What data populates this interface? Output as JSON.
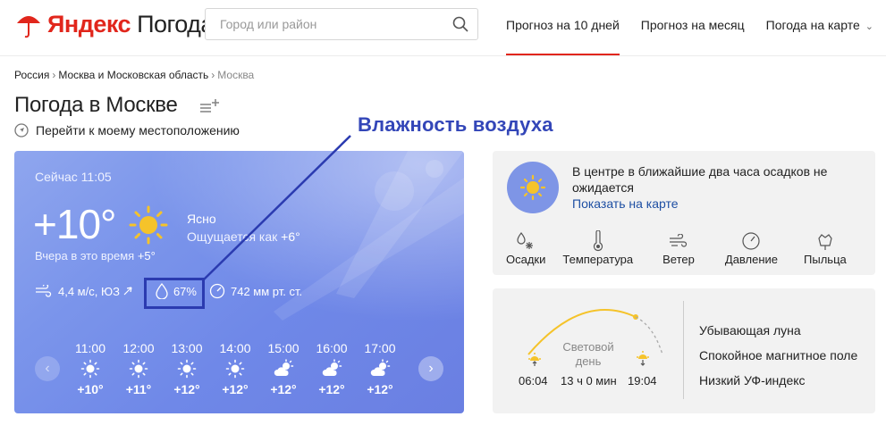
{
  "header": {
    "logo_brand": "Яндекс",
    "logo_product": "Погода",
    "search_placeholder": "Город или район",
    "nav": [
      {
        "label": "Прогноз на 10 дней",
        "active": true
      },
      {
        "label": "Прогноз на месяц",
        "active": false
      },
      {
        "label": "Погода на карте",
        "active": false
      }
    ]
  },
  "breadcrumb": {
    "items": [
      "Россия",
      "Москва и Московская область",
      "Москва"
    ],
    "separator": "›"
  },
  "page": {
    "title": "Погода в Москве",
    "locate_label": "Перейти к моему местоположению"
  },
  "annotation": {
    "label": "Влажность воздуха",
    "color": "#3346b8"
  },
  "current": {
    "now_label": "Сейчас 11:05",
    "temperature": "+10°",
    "condition": "Ясно",
    "feels_like_label": "Ощущается как",
    "feels_like_value": "+6°",
    "yesterday_label": "Вчера в это время",
    "yesterday_value": "+5°",
    "wind": "4,4 м/с, ЮЗ",
    "humidity": "67%",
    "pressure": "742 мм рт. ст."
  },
  "hourly": [
    {
      "time": "11:00",
      "icon": "sun-icon",
      "temp": "+10°"
    },
    {
      "time": "12:00",
      "icon": "sun-icon",
      "temp": "+11°"
    },
    {
      "time": "13:00",
      "icon": "sun-icon",
      "temp": "+12°"
    },
    {
      "time": "14:00",
      "icon": "sun-icon",
      "temp": "+12°"
    },
    {
      "time": "15:00",
      "icon": "partly-cloudy-icon",
      "temp": "+12°"
    },
    {
      "time": "16:00",
      "icon": "partly-cloudy-icon",
      "temp": "+12°"
    },
    {
      "time": "17:00",
      "icon": "partly-cloudy-icon",
      "temp": "+12°"
    }
  ],
  "precip_panel": {
    "text": "В центре в ближайшие два часа осадков не ожидается",
    "map_link": "Показать на карте",
    "quick": [
      {
        "label": "Осадки",
        "icon": "precipitation-icon"
      },
      {
        "label": "Температура",
        "icon": "thermometer-icon"
      },
      {
        "label": "Ветер",
        "icon": "wind-icon"
      },
      {
        "label": "Давление",
        "icon": "gauge-icon"
      },
      {
        "label": "Пыльца",
        "icon": "pollen-icon"
      }
    ]
  },
  "day_panel": {
    "sunrise": "06:04",
    "sunset": "19:04",
    "daylight_label_1": "Световой",
    "daylight_label_2": "день",
    "daylight_duration": "13 ч 0 мин",
    "facts": [
      "Убывающая луна",
      "Спокойное магнитное поле",
      "Низкий УФ-индекс"
    ]
  },
  "colors": {
    "brand_red": "#e1261c",
    "card_blue": "#7b95eb",
    "sun_yellow": "#f5c32a",
    "link_blue": "#1e4fa3"
  }
}
